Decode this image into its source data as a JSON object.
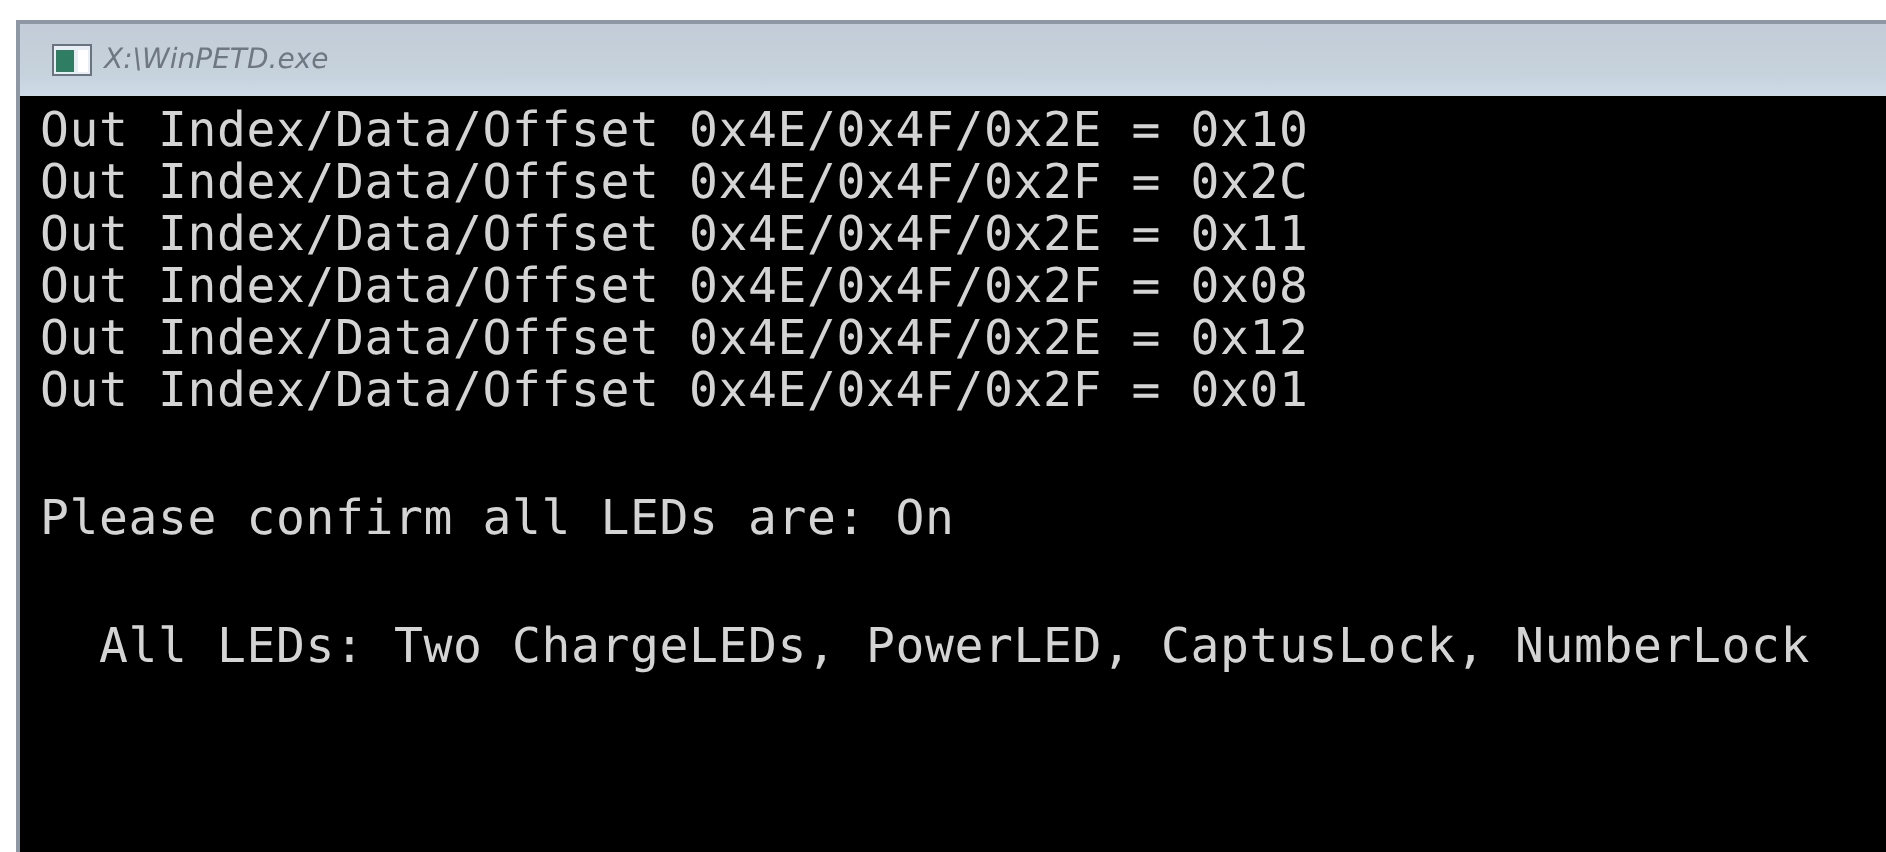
{
  "window": {
    "title": "X:\\WinPETD.exe"
  },
  "console": {
    "blocks": [
      {
        "lines": [
          "Out Index/Data/Offset 0x4E/0x4F/0x2E = 0x10",
          "Out Index/Data/Offset 0x4E/0x4F/0x2F = 0x2C",
          "Out Index/Data/Offset 0x4E/0x4F/0x2E = 0x11",
          "Out Index/Data/Offset 0x4E/0x4F/0x2F = 0x08",
          "Out Index/Data/Offset 0x4E/0x4F/0x2E = 0x12",
          "Out Index/Data/Offset 0x4E/0x4F/0x2F = 0x01"
        ]
      },
      {
        "lines": [
          "Please confirm all LEDs are: On"
        ]
      },
      {
        "lines": [
          "  All LEDs: Two ChargeLEDs, PowerLED, CaptusLock, NumberLock"
        ]
      }
    ]
  }
}
